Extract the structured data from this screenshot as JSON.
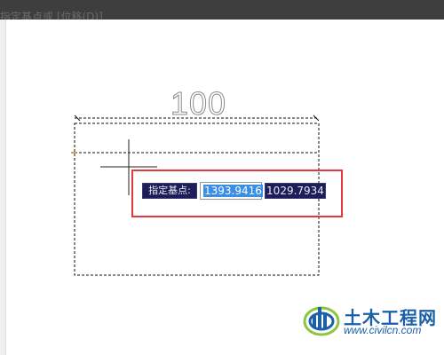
{
  "command_line": {
    "text": "指定基点或 [位移(D)]"
  },
  "dimension": {
    "value": "100"
  },
  "prompt": {
    "label": "指定基点:",
    "x_value": "1393.9416",
    "y_value": "1029.7934"
  },
  "watermark": {
    "brand": "土木工程网",
    "url": "www.civilcn.com"
  },
  "colors": {
    "highlight_frame": "#e3383c",
    "prompt_bg": "#1d1d57",
    "selection": "#3a8ee6",
    "brand": "#1b5fa8"
  },
  "icons": {
    "crosshair": "crosshair-cursor-icon",
    "logo": "civilcn-logo-icon"
  }
}
